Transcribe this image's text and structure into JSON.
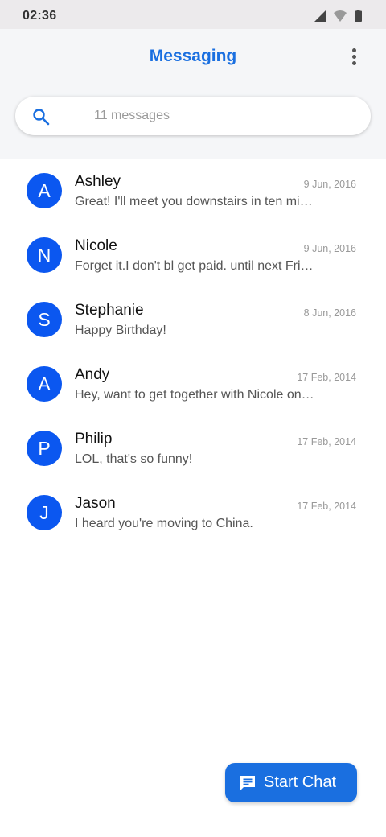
{
  "status_bar": {
    "time": "02:36",
    "icons": [
      "signal-icon",
      "wifi-icon",
      "battery-icon"
    ]
  },
  "header": {
    "title": "Messaging",
    "title_color": "#1a6fe0",
    "menu_icon": "more-vert-icon"
  },
  "search": {
    "placeholder": "11 messages",
    "value": "",
    "icon": "search-icon"
  },
  "conversations": [
    {
      "initial": "A",
      "name": "Ashley",
      "date": "9 Jun, 2016",
      "preview": "Great! I'll meet you downstairs in ten minutes."
    },
    {
      "initial": "N",
      "name": "Nicole",
      "date": "9 Jun, 2016",
      "preview": "Forget it.I don't bl get paid. until next Friday."
    },
    {
      "initial": "S",
      "name": "Stephanie",
      "date": "8 Jun, 2016",
      "preview": "Happy Birthday!"
    },
    {
      "initial": "A",
      "name": "Andy",
      "date": "17 Feb, 2014",
      "preview": "Hey, want to get together with Nicole on Saturday?"
    },
    {
      "initial": "P",
      "name": "Philip",
      "date": "17 Feb, 2014",
      "preview": "LOL, that's so funny!"
    },
    {
      "initial": "J",
      "name": "Jason",
      "date": "17 Feb, 2014",
      "preview": "I heard you're moving to China."
    }
  ],
  "fab": {
    "label": "Start Chat",
    "icon": "chat-icon",
    "color": "#1a6fe0"
  },
  "colors": {
    "avatar": "#0b57f0",
    "accent": "#1a6fe0"
  }
}
